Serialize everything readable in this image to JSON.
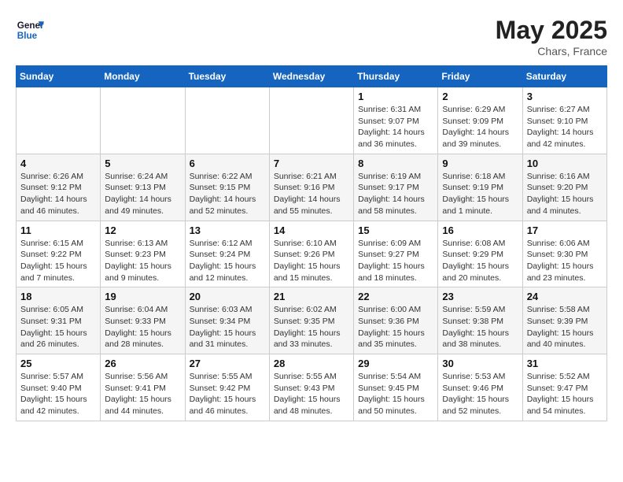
{
  "header": {
    "logo_general": "General",
    "logo_blue": "Blue",
    "month_year": "May 2025",
    "location": "Chars, France"
  },
  "weekdays": [
    "Sunday",
    "Monday",
    "Tuesday",
    "Wednesday",
    "Thursday",
    "Friday",
    "Saturday"
  ],
  "weeks": [
    [
      {
        "day": "",
        "info": ""
      },
      {
        "day": "",
        "info": ""
      },
      {
        "day": "",
        "info": ""
      },
      {
        "day": "",
        "info": ""
      },
      {
        "day": "1",
        "info": "Sunrise: 6:31 AM\nSunset: 9:07 PM\nDaylight: 14 hours\nand 36 minutes."
      },
      {
        "day": "2",
        "info": "Sunrise: 6:29 AM\nSunset: 9:09 PM\nDaylight: 14 hours\nand 39 minutes."
      },
      {
        "day": "3",
        "info": "Sunrise: 6:27 AM\nSunset: 9:10 PM\nDaylight: 14 hours\nand 42 minutes."
      }
    ],
    [
      {
        "day": "4",
        "info": "Sunrise: 6:26 AM\nSunset: 9:12 PM\nDaylight: 14 hours\nand 46 minutes."
      },
      {
        "day": "5",
        "info": "Sunrise: 6:24 AM\nSunset: 9:13 PM\nDaylight: 14 hours\nand 49 minutes."
      },
      {
        "day": "6",
        "info": "Sunrise: 6:22 AM\nSunset: 9:15 PM\nDaylight: 14 hours\nand 52 minutes."
      },
      {
        "day": "7",
        "info": "Sunrise: 6:21 AM\nSunset: 9:16 PM\nDaylight: 14 hours\nand 55 minutes."
      },
      {
        "day": "8",
        "info": "Sunrise: 6:19 AM\nSunset: 9:17 PM\nDaylight: 14 hours\nand 58 minutes."
      },
      {
        "day": "9",
        "info": "Sunrise: 6:18 AM\nSunset: 9:19 PM\nDaylight: 15 hours\nand 1 minute."
      },
      {
        "day": "10",
        "info": "Sunrise: 6:16 AM\nSunset: 9:20 PM\nDaylight: 15 hours\nand 4 minutes."
      }
    ],
    [
      {
        "day": "11",
        "info": "Sunrise: 6:15 AM\nSunset: 9:22 PM\nDaylight: 15 hours\nand 7 minutes."
      },
      {
        "day": "12",
        "info": "Sunrise: 6:13 AM\nSunset: 9:23 PM\nDaylight: 15 hours\nand 9 minutes."
      },
      {
        "day": "13",
        "info": "Sunrise: 6:12 AM\nSunset: 9:24 PM\nDaylight: 15 hours\nand 12 minutes."
      },
      {
        "day": "14",
        "info": "Sunrise: 6:10 AM\nSunset: 9:26 PM\nDaylight: 15 hours\nand 15 minutes."
      },
      {
        "day": "15",
        "info": "Sunrise: 6:09 AM\nSunset: 9:27 PM\nDaylight: 15 hours\nand 18 minutes."
      },
      {
        "day": "16",
        "info": "Sunrise: 6:08 AM\nSunset: 9:29 PM\nDaylight: 15 hours\nand 20 minutes."
      },
      {
        "day": "17",
        "info": "Sunrise: 6:06 AM\nSunset: 9:30 PM\nDaylight: 15 hours\nand 23 minutes."
      }
    ],
    [
      {
        "day": "18",
        "info": "Sunrise: 6:05 AM\nSunset: 9:31 PM\nDaylight: 15 hours\nand 26 minutes."
      },
      {
        "day": "19",
        "info": "Sunrise: 6:04 AM\nSunset: 9:33 PM\nDaylight: 15 hours\nand 28 minutes."
      },
      {
        "day": "20",
        "info": "Sunrise: 6:03 AM\nSunset: 9:34 PM\nDaylight: 15 hours\nand 31 minutes."
      },
      {
        "day": "21",
        "info": "Sunrise: 6:02 AM\nSunset: 9:35 PM\nDaylight: 15 hours\nand 33 minutes."
      },
      {
        "day": "22",
        "info": "Sunrise: 6:00 AM\nSunset: 9:36 PM\nDaylight: 15 hours\nand 35 minutes."
      },
      {
        "day": "23",
        "info": "Sunrise: 5:59 AM\nSunset: 9:38 PM\nDaylight: 15 hours\nand 38 minutes."
      },
      {
        "day": "24",
        "info": "Sunrise: 5:58 AM\nSunset: 9:39 PM\nDaylight: 15 hours\nand 40 minutes."
      }
    ],
    [
      {
        "day": "25",
        "info": "Sunrise: 5:57 AM\nSunset: 9:40 PM\nDaylight: 15 hours\nand 42 minutes."
      },
      {
        "day": "26",
        "info": "Sunrise: 5:56 AM\nSunset: 9:41 PM\nDaylight: 15 hours\nand 44 minutes."
      },
      {
        "day": "27",
        "info": "Sunrise: 5:55 AM\nSunset: 9:42 PM\nDaylight: 15 hours\nand 46 minutes."
      },
      {
        "day": "28",
        "info": "Sunrise: 5:55 AM\nSunset: 9:43 PM\nDaylight: 15 hours\nand 48 minutes."
      },
      {
        "day": "29",
        "info": "Sunrise: 5:54 AM\nSunset: 9:45 PM\nDaylight: 15 hours\nand 50 minutes."
      },
      {
        "day": "30",
        "info": "Sunrise: 5:53 AM\nSunset: 9:46 PM\nDaylight: 15 hours\nand 52 minutes."
      },
      {
        "day": "31",
        "info": "Sunrise: 5:52 AM\nSunset: 9:47 PM\nDaylight: 15 hours\nand 54 minutes."
      }
    ]
  ]
}
